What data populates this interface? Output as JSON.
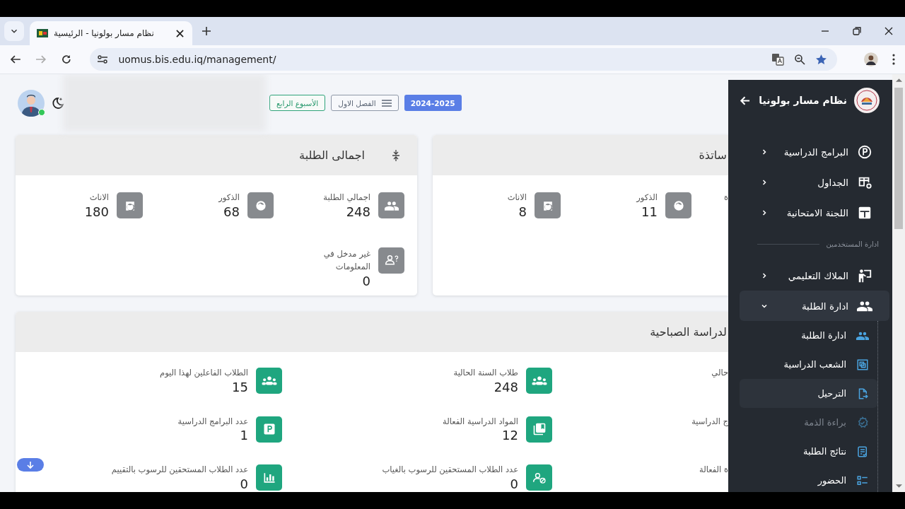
{
  "browser": {
    "tab_title": "نظام مسار بولونيا - الرئيسية",
    "url": "uomus.bis.edu.iq/management/"
  },
  "header": {
    "user_online": true,
    "badges": [
      {
        "label": "2024-2025",
        "kind": "primary"
      },
      {
        "label": "الفصل الاول",
        "kind": "menu"
      },
      {
        "label": "الأسبوع الرابع",
        "kind": "success"
      }
    ]
  },
  "students_card": {
    "title": "اجمالى الطلبة",
    "stats": [
      {
        "label": "اجمالي الطلبة",
        "value": "248"
      },
      {
        "label": "الذكور",
        "value": "68"
      },
      {
        "label": "الاناث",
        "value": "180"
      },
      {
        "label": "غير مدخل في المعلومات",
        "value": "0"
      }
    ]
  },
  "teachers_card": {
    "title": "ساتذة",
    "stats": [
      {
        "label": "ة"
      },
      {
        "label": "الذكور",
        "value": "11"
      },
      {
        "label": "الاناث",
        "value": "8"
      }
    ]
  },
  "morning_card": {
    "title": "لدراسة الصباحية",
    "stats": [
      {
        "label": "حالي"
      },
      {
        "label": "طلاب السنة الحالية",
        "value": "248"
      },
      {
        "label": "الطلاب الفاعلين لهذا اليوم",
        "value": "15"
      },
      {
        "label": "ج الدراسية"
      },
      {
        "label": "المواد الدراسية الفعالة",
        "value": "12"
      },
      {
        "label": "عدد البرامج الدراسية",
        "value": "1"
      },
      {
        "label": "ة الفعالة"
      },
      {
        "label": "عدد الطلاب المستحقين للرسوب بالغياب",
        "value": "0"
      },
      {
        "label": "عدد الطلاب المستحقين للرسوب بالتقييم",
        "value": "0"
      }
    ]
  },
  "sidebar": {
    "title": "نظام مسار بولونيا",
    "items": [
      {
        "kind": "item",
        "label": "البرامج الدراسية",
        "expanded": false
      },
      {
        "kind": "item",
        "label": "الجداول",
        "expanded": false
      },
      {
        "kind": "item",
        "label": "اللجنة الامتحانية",
        "expanded": false
      },
      {
        "kind": "section",
        "label": "ادارة المستخدمين"
      },
      {
        "kind": "item",
        "label": "الملاك التعليمي",
        "expanded": false
      },
      {
        "kind": "item",
        "label": "ادارة الطلبة",
        "expanded": true,
        "children": [
          {
            "label": "ادارة الطلبة",
            "highlighted": false,
            "disabled": false
          },
          {
            "label": "الشعب الدراسية",
            "highlighted": false,
            "disabled": false
          },
          {
            "label": "الترحيل",
            "highlighted": true,
            "disabled": false
          },
          {
            "label": "براءة الذمة",
            "highlighted": false,
            "disabled": true
          },
          {
            "label": "نتائج الطلبة",
            "highlighted": false,
            "disabled": false
          },
          {
            "label": "الحضور",
            "highlighted": false,
            "disabled": false
          }
        ]
      }
    ]
  }
}
